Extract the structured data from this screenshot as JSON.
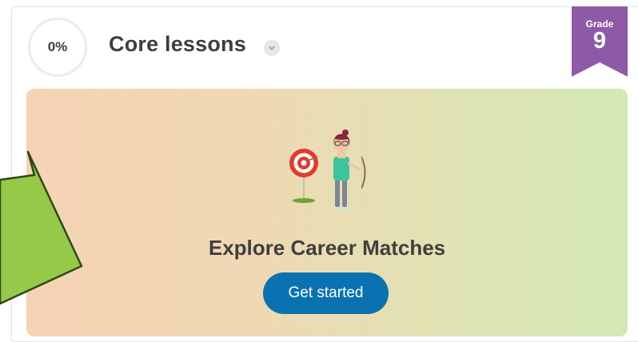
{
  "lesson": {
    "progress_text": "0%",
    "progress_value": 0,
    "title": "Core lessons"
  },
  "grade": {
    "label": "Grade",
    "value": "9",
    "ribbon_color": "#8e5aa8"
  },
  "banner": {
    "heading": "Explore Career Matches",
    "button_label": "Get started",
    "button_color": "#0a72b1",
    "gradient_left": "#f6d3b5",
    "gradient_right": "#d3e8b3"
  },
  "icons": {
    "dropdown": "chevron-down-icon",
    "illustration": "archer-target-illustration",
    "overlay": "green-arrow-annotation"
  },
  "annotation": {
    "arrow_color": "#96c84a",
    "arrow_outline": "#2d4a12"
  }
}
